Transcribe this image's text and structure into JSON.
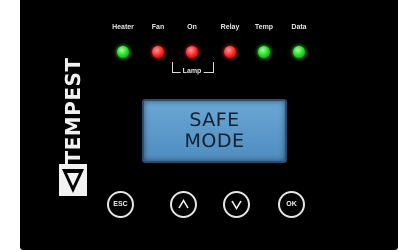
{
  "brand": {
    "name": "TEMPEST"
  },
  "indicators": [
    {
      "label": "Heater",
      "state": "on",
      "color": "#1ad61a"
    },
    {
      "label": "Fan",
      "state": "on",
      "color": "#ff1b1b"
    },
    {
      "label": "On",
      "state": "on",
      "color": "#ff1b1b"
    },
    {
      "label": "Relay",
      "state": "on",
      "color": "#ff1b1b"
    },
    {
      "label": "Temp",
      "state": "on",
      "color": "#1ad61a"
    },
    {
      "label": "Data",
      "state": "on",
      "color": "#1ad61a"
    }
  ],
  "lamp_group_label": "Lamp",
  "display": {
    "line1": "SAFE",
    "line2": "MODE",
    "background": "#5a98c9"
  },
  "buttons": [
    {
      "label": "ESC"
    },
    {
      "label": "up"
    },
    {
      "label": "down"
    },
    {
      "label": "OK"
    }
  ]
}
